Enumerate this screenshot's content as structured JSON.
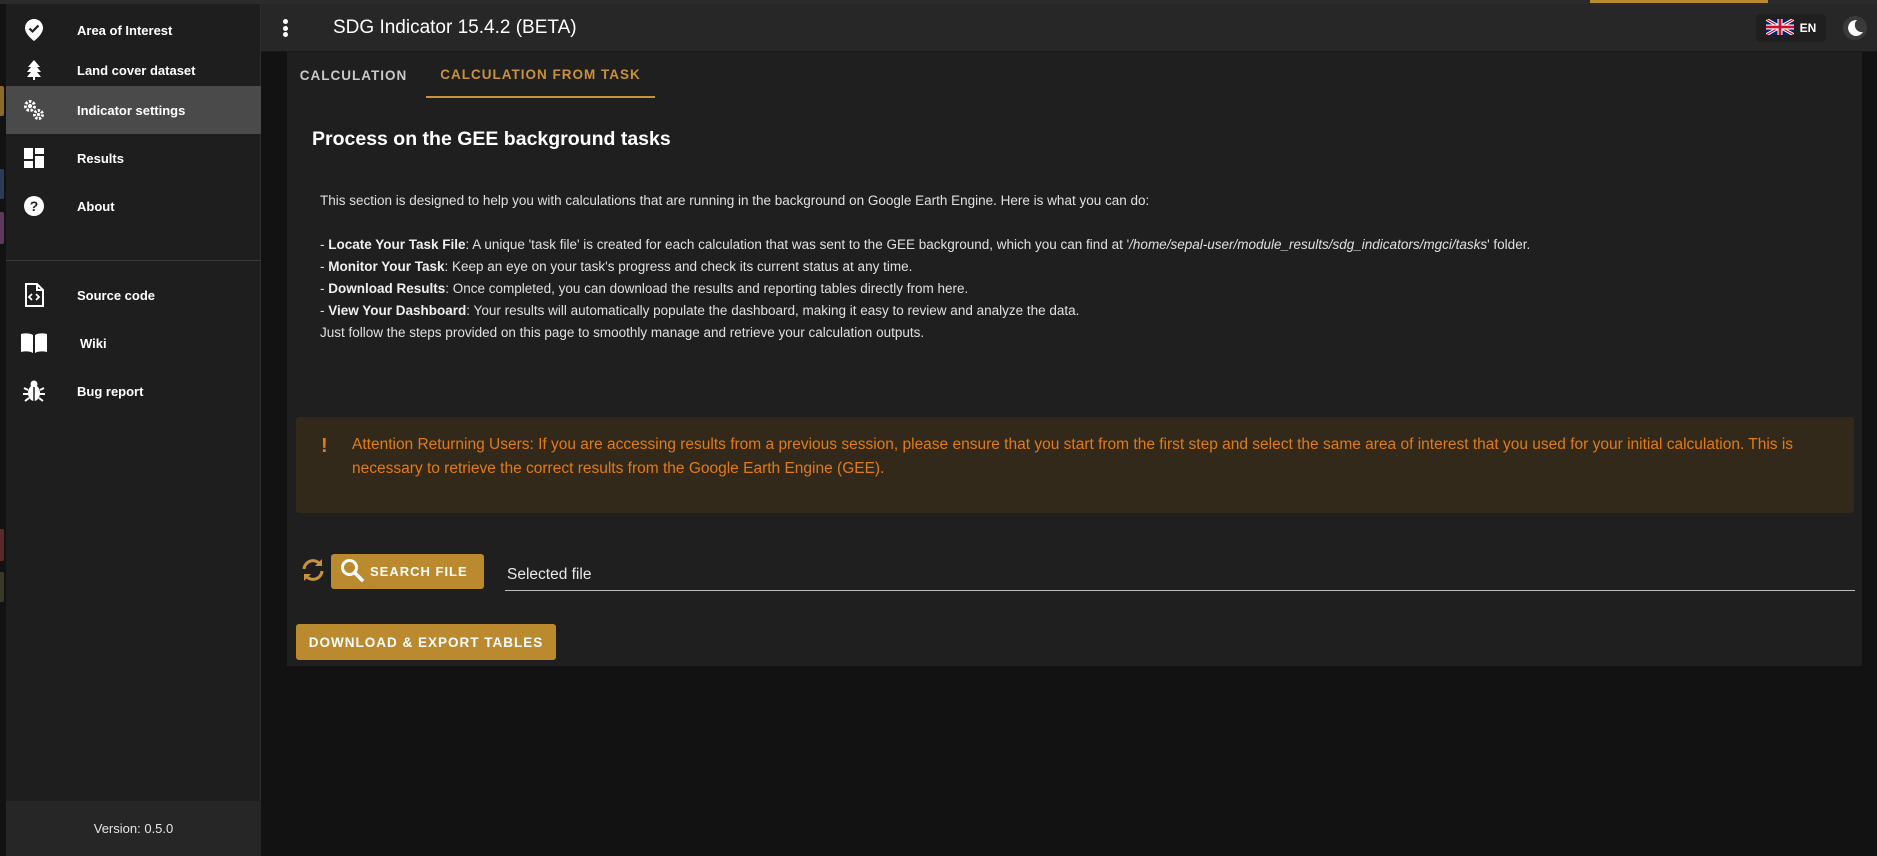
{
  "app": {
    "title": "SDG Indicator 15.4.2 (BETA)",
    "language": "EN",
    "version": "Version: 0.5.0"
  },
  "sidebar": {
    "items": [
      {
        "label": "Area of Interest",
        "icon": "map-marker-check-icon"
      },
      {
        "label": "Land cover dataset",
        "icon": "tree-icon"
      },
      {
        "label": "Indicator settings",
        "icon": "cogs-icon",
        "active": true
      },
      {
        "label": "Results",
        "icon": "dashboard-icon"
      },
      {
        "label": "About",
        "icon": "help-circle-icon"
      }
    ],
    "links": [
      {
        "label": "Source code",
        "icon": "file-code-icon"
      },
      {
        "label": "Wiki",
        "icon": "book-open-icon"
      },
      {
        "label": "Bug report",
        "icon": "bug-icon"
      }
    ]
  },
  "tabs": [
    {
      "label": "CALCULATION"
    },
    {
      "label": "CALCULATION FROM TASK",
      "active": true
    }
  ],
  "content": {
    "title": "Process on the GEE background tasks",
    "intro": "This section is designed to help you with calculations that are running in the background on Google Earth Engine. Here is what you can do:",
    "steps": [
      {
        "bold": "Locate Your Task File",
        "text_before": ": A unique 'task file' is created for each calculation that was sent to the GEE background, which you can find at '",
        "italic": "/home/sepal-user/module_results/sdg_indicators/mgci/tasks",
        "text_after": "' folder."
      },
      {
        "bold": "Monitor Your Task",
        "text": ": Keep an eye on your task's progress and check its current status at any time."
      },
      {
        "bold": "Download Results",
        "text": ": Once completed, you can download the results and reporting tables directly from here."
      },
      {
        "bold": "View Your Dashboard",
        "text": ": Your results will automatically populate the dashboard, making it easy to review and analyze the data."
      }
    ],
    "outro": "Just follow the steps provided on this page to smoothly manage and retrieve your calculation outputs.",
    "alert": "Attention Returning Users: If you are accessing results from a previous session, please ensure that you start from the first step and select the same area of interest that you used for your initial calculation. This is necessary to retrieve the correct results from the Google Earth Engine (GEE).",
    "alert_icon": "!",
    "search_button": "SEARCH FILE",
    "file_label": "Selected file",
    "download_button": "DOWNLOAD & EXPORT TABLES"
  },
  "colors": {
    "accent": "#bb8a2f",
    "tab_active": "#c8913a",
    "alert_text": "#e07b17",
    "alert_bg": "#33291b"
  }
}
